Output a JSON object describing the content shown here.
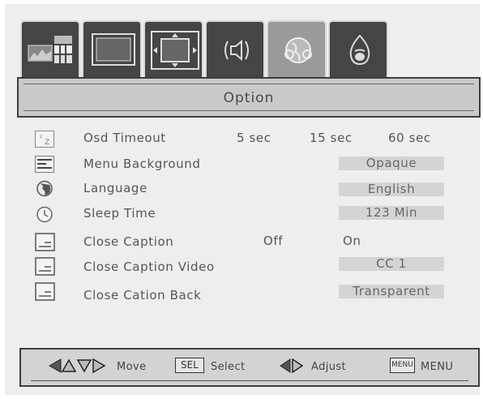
{
  "tabs": [
    {
      "icon": "picture-settings-icon",
      "active": false
    },
    {
      "icon": "screen-icon",
      "active": false
    },
    {
      "icon": "screen-adjust-icon",
      "active": false
    },
    {
      "icon": "audio-icon",
      "active": false
    },
    {
      "icon": "option-globe-icon",
      "active": true
    },
    {
      "icon": "parental-lock-icon",
      "active": false
    }
  ],
  "header": {
    "title": "Option"
  },
  "rows": {
    "osd_timeout": {
      "label": "Osd Timeout",
      "options": [
        "5 sec",
        "15 sec",
        "60 sec"
      ],
      "icon": "sleep-zz-icon"
    },
    "menu_background": {
      "label": "Menu Background",
      "value": "Opaque",
      "icon": "menu-list-icon"
    },
    "language": {
      "label": "Language",
      "value": "English",
      "icon": "globe-icon"
    },
    "sleep_time": {
      "label": "Sleep Time",
      "value": "123 Min",
      "icon": "clock-icon"
    },
    "close_caption": {
      "label": "Close Caption",
      "options": [
        "Off",
        "On"
      ],
      "icon": "caption-icon"
    },
    "close_caption_video": {
      "label": "Close Caption Video",
      "value": "CC 1",
      "icon": "caption-icon"
    },
    "close_cation_back": {
      "label": "Close Cation Back",
      "value": "Transparent",
      "icon": "caption-icon"
    }
  },
  "footer": {
    "move_label": "Move",
    "sel_key": "SEL",
    "select_label": "Select",
    "adjust_label": "Adjust",
    "menu_key": "MENU",
    "menu_label": "MENU"
  },
  "colors": {
    "tab": "#454545",
    "tab_active": "#9a9a9a",
    "value_bg": "#d4d4d4",
    "bar_bg": "#c9c9c9"
  }
}
